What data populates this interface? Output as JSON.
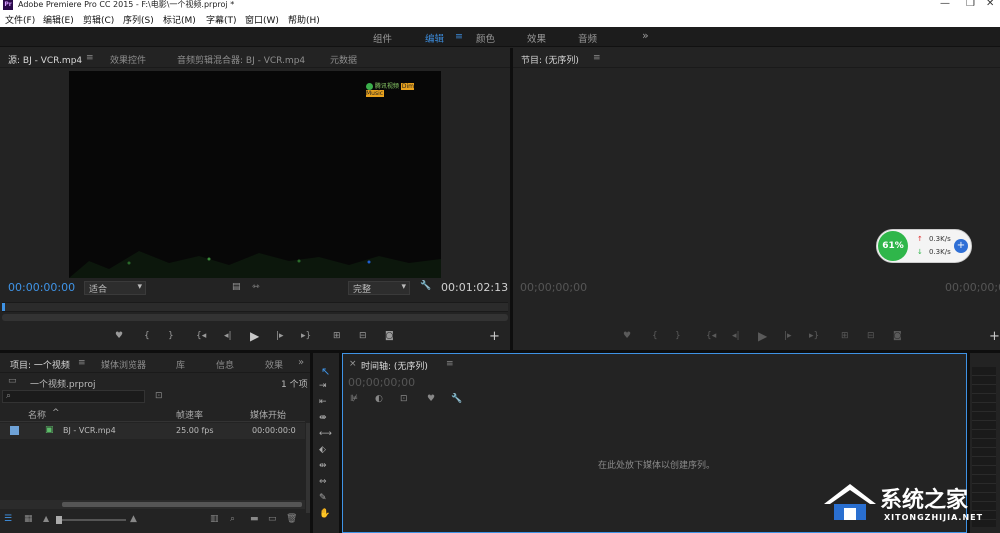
{
  "window": {
    "app_icon": "Pr",
    "title": "Adobe Premiere Pro CC 2015 - F:\\电影\\一个视频.prproj *"
  },
  "menu": [
    "文件(F)",
    "编辑(E)",
    "剪辑(C)",
    "序列(S)",
    "标记(M)",
    "字幕(T)",
    "窗口(W)",
    "帮助(H)"
  ],
  "workspaces": {
    "items": [
      "组件",
      "编辑",
      "颜色",
      "效果",
      "音频"
    ],
    "active": "编辑",
    "more": "»",
    "menu_icon": "≡"
  },
  "source_panel": {
    "tabs": [
      "源: BJ - VCR.mp4",
      "效果控件",
      "音频剪辑混合器: BJ - VCR.mp4",
      "元数据"
    ],
    "watermark": "腾讯视频",
    "timecode_in": "00:00:00:00",
    "fit_label": "适合",
    "quality_label": "完整",
    "timecode_duration": "00:01:02:13"
  },
  "program_panel": {
    "tab": "节目: (无序列)",
    "timecode_left": "00;00;00;00",
    "timecode_right": "00;00;00;00"
  },
  "net_widget": {
    "percent": "61%",
    "up": "0.3K/s",
    "down": "0.3K/s"
  },
  "project_panel": {
    "tabs": [
      "项目: 一个视频",
      "媒体浏览器",
      "库",
      "信息",
      "效果"
    ],
    "project_file": "一个视频.prproj",
    "item_count": "1 个项",
    "columns": [
      "名称",
      "帧速率",
      "媒体开始"
    ],
    "rows": [
      {
        "name": "BJ - VCR.mp4",
        "fps": "25.00 fps",
        "start": "00:00:00:0"
      }
    ]
  },
  "timeline_panel": {
    "tab": "时间轴: (无序列)",
    "timecode": "00;00;00;00",
    "empty_hint": "在此处放下媒体以创建序列。"
  },
  "brand_watermark": {
    "name": "系统之家",
    "url": "XITONGZHIJIA.NET"
  },
  "colors": {
    "accent_blue": "#3f93e5",
    "panel_bg": "#232323",
    "net_green": "#2fb64a"
  }
}
